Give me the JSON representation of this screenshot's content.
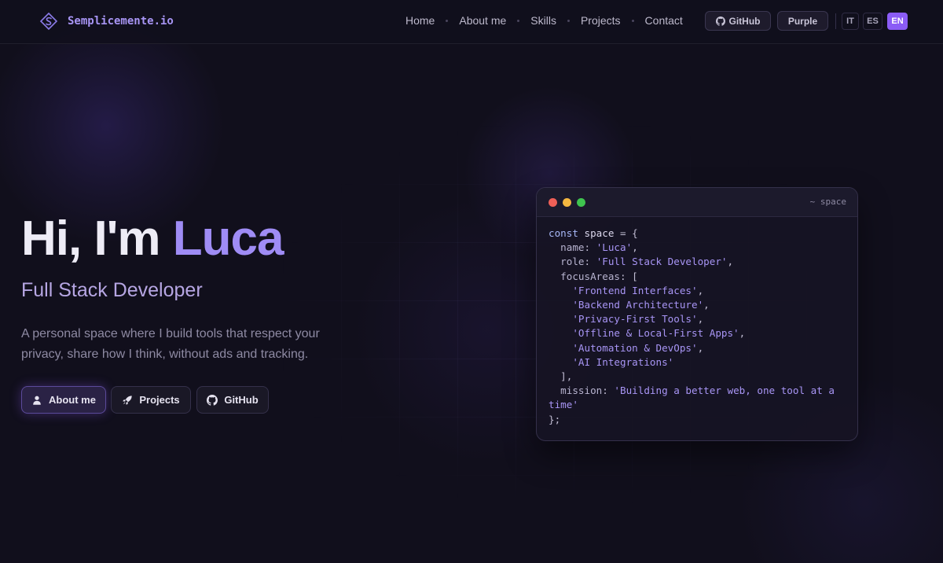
{
  "nav": {
    "brand": "Semplicemente.io",
    "links": [
      "Home",
      "About me",
      "Skills",
      "Projects",
      "Contact"
    ],
    "github_label": "GitHub",
    "theme_label": "Purple",
    "languages": [
      "IT",
      "ES",
      "EN"
    ],
    "active_language": "EN"
  },
  "hero": {
    "greeting": "Hi, I'm",
    "name": "Luca",
    "role": "Full Stack Developer",
    "description": "A personal space where I build tools that respect your privacy, share how I think, without ads and tracking.",
    "buttons": {
      "about": "About me",
      "projects": "Projects",
      "github": "GitHub"
    }
  },
  "code": {
    "window_title": "~ space",
    "keyword": "const",
    "variable": "space",
    "keys": {
      "name": "name",
      "role": "role",
      "focus": "focusAreas",
      "mission": "mission"
    },
    "name_value": "'Luca'",
    "role_value": "'Full Stack Developer'",
    "focus_areas": [
      "'Frontend Interfaces'",
      "'Backend Architecture'",
      "'Privacy-First Tools'",
      "'Offline & Local-First Apps'",
      "'Automation & DevOps'",
      "'AI Integrations'"
    ],
    "mission_value": "'Building a better web, one tool at a time'"
  },
  "colors": {
    "background": "#110f1c",
    "accent": "#8b5cf6",
    "accent_text": "#a895f5"
  }
}
